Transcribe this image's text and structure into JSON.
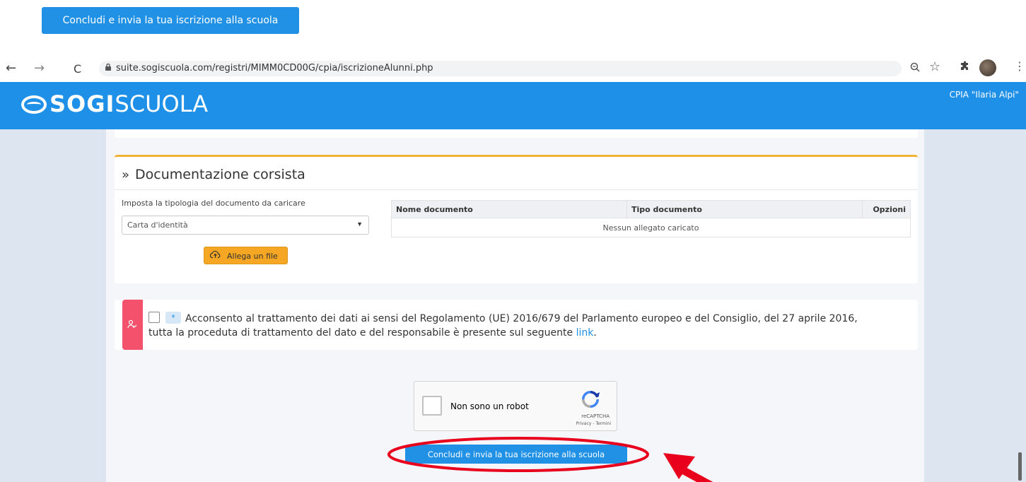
{
  "top_button": {
    "label": "Concludi e invia la tua iscrizione alla scuola"
  },
  "browser": {
    "url": "suite.sogiscuola.com/registri/MIMM0CD00G/cpia/iscrizioneAlunni.php",
    "icons": [
      "back-arrow-icon",
      "forward-arrow-icon",
      "reload-icon",
      "lock-icon",
      "zoom-icon",
      "star-icon",
      "extensions-icon",
      "kebab-menu-icon"
    ]
  },
  "header": {
    "logo_bold": "SOGI",
    "logo_light": "SCUOLA",
    "school_name": "CPIA \"Ilaria Alpi\"",
    "bg_color": "#1e90e8"
  },
  "documentation": {
    "title": "Documentazione corsista",
    "type_label": "Imposta la tipologia del documento da caricare",
    "selected_type": "Carta d'identità",
    "attach_label": "Allega un file",
    "table": {
      "headers": [
        "Nome documento",
        "Tipo documento",
        "Opzioni"
      ],
      "empty_message": "Nessun allegato caricato"
    },
    "accent_color": "#f2b233"
  },
  "consent": {
    "line1": "Acconsento al trattamento dei dati ai sensi del Regolamento (UE) 2016/679 del Parlamento europeo e del Consiglio, del 27 aprile 2016,",
    "line2": "tutta la proceduta di trattamento del dato e del responsabile è presente sul seguente ",
    "link": "link",
    "line2_end": ".",
    "required_marker": "*",
    "accent_color": "#f4516c"
  },
  "recaptcha": {
    "label": "Non sono un robot",
    "brand": "reCAPTCHA",
    "terms": "Privacy - Termini"
  },
  "submit_button": {
    "label": "Concludi e invia la tua iscrizione alla scuola"
  },
  "annotation_color": "#e8001c"
}
